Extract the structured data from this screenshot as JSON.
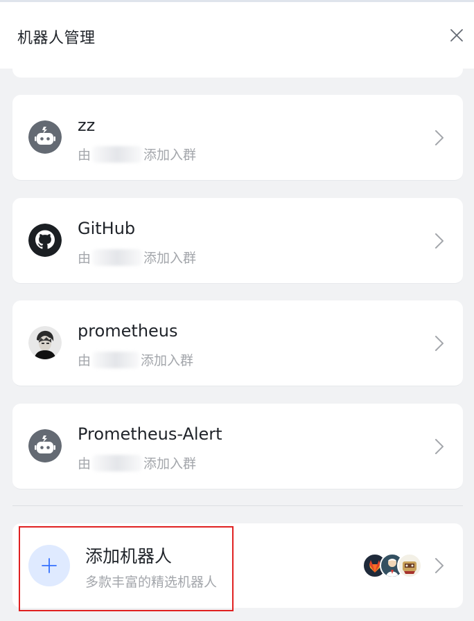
{
  "dialog": {
    "title": "机器人管理",
    "close_icon": "close-icon"
  },
  "bots": [
    {
      "name": "zz",
      "prefix": "由",
      "suffix": "添加入群",
      "avatar": "robot-icon"
    },
    {
      "name": "GitHub",
      "prefix": "由",
      "suffix": "添加入群",
      "avatar": "github-icon"
    },
    {
      "name": "prometheus",
      "prefix": "由 ",
      "suffix": "添加入群",
      "avatar": "user-avatar"
    },
    {
      "name": "Prometheus-Alert",
      "prefix": "由",
      "suffix": "添加入群",
      "avatar": "robot-icon"
    }
  ],
  "add_bot": {
    "title": "添加机器人",
    "subtitle": "多款丰富的精选机器人",
    "icon": "plus-icon",
    "preview_avatars": [
      "gitlab-icon",
      "jenkins-icon",
      "jira-icon"
    ]
  },
  "colors": {
    "background": "#f1f2f4",
    "card": "#ffffff",
    "robot_avatar": "#646a73",
    "accent": "#3370ff",
    "highlight": "#e02020"
  }
}
